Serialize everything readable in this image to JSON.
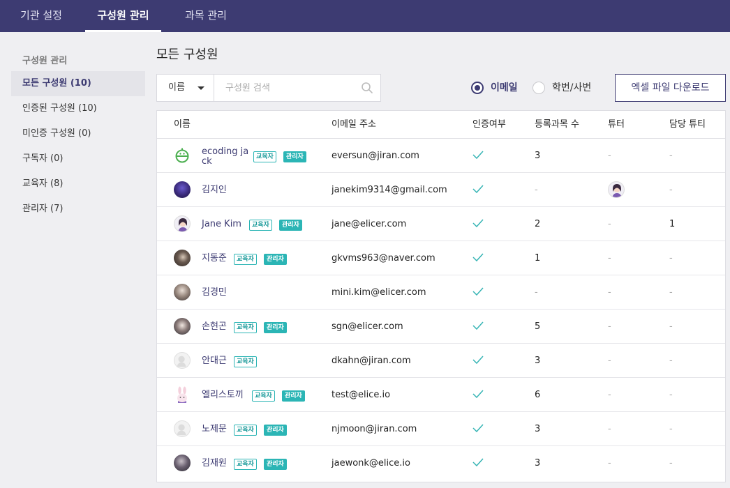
{
  "top_nav": {
    "tabs": [
      {
        "label": "기관 설정",
        "active": false
      },
      {
        "label": "구성원 관리",
        "active": true
      },
      {
        "label": "과목 관리",
        "active": false
      }
    ]
  },
  "sidebar": {
    "title": "구성원 관리",
    "items": [
      {
        "label": "모든 구성원 (10)",
        "active": true
      },
      {
        "label": "인증된 구성원 (10)",
        "active": false
      },
      {
        "label": "미인증 구성원 (0)",
        "active": false
      },
      {
        "label": "구독자 (0)",
        "active": false
      },
      {
        "label": "교육자 (8)",
        "active": false
      },
      {
        "label": "관리자 (7)",
        "active": false
      }
    ]
  },
  "main": {
    "title": "모든 구성원",
    "search": {
      "select_value": "이름",
      "placeholder": "구성원 검색"
    },
    "radio_options": [
      {
        "label": "이메일",
        "checked": true
      },
      {
        "label": "학번/사번",
        "checked": false
      }
    ],
    "download_label": "엑셀 파일 다운로드",
    "table": {
      "headers": [
        "이름",
        "이메일 주소",
        "인증여부",
        "등록과목 수",
        "튜터",
        "담당 튜티"
      ],
      "badge_labels": {
        "edu": "교육자",
        "admin": "관리자"
      },
      "rows": [
        {
          "name": "ecoding jack",
          "email": "eversun@jiran.com",
          "verified": true,
          "courses": "3",
          "tutor": "-",
          "tutee": "-",
          "edu": true,
          "admin": true,
          "avatar": "elice-logo-icon"
        },
        {
          "name": "김지인",
          "email": "janekim9314@gmail.com",
          "verified": true,
          "courses": "-",
          "tutor": "avatar",
          "tutee": "-",
          "edu": false,
          "admin": false,
          "avatar": "purple-avatar-icon"
        },
        {
          "name": "Jane Kim",
          "email": "jane@elicer.com",
          "verified": true,
          "courses": "2",
          "tutor": "-",
          "tutee": "1",
          "edu": true,
          "admin": true,
          "avatar": "girl-avatar-icon"
        },
        {
          "name": "지동준",
          "email": "gkvms963@naver.com",
          "verified": true,
          "courses": "1",
          "tutor": "-",
          "tutee": "-",
          "edu": true,
          "admin": true,
          "avatar": "photo-avatar-icon"
        },
        {
          "name": "김경민",
          "email": "mini.kim@elicer.com",
          "verified": true,
          "courses": "-",
          "tutor": "-",
          "tutee": "-",
          "edu": false,
          "admin": false,
          "avatar": "photo-avatar-icon"
        },
        {
          "name": "손현곤",
          "email": "sgn@elicer.com",
          "verified": true,
          "courses": "5",
          "tutor": "-",
          "tutee": "-",
          "edu": true,
          "admin": true,
          "avatar": "photo-avatar-icon"
        },
        {
          "name": "안대근",
          "email": "dkahn@jiran.com",
          "verified": true,
          "courses": "3",
          "tutor": "-",
          "tutee": "-",
          "edu": true,
          "admin": false,
          "avatar": "default-avatar-icon"
        },
        {
          "name": "엘리스토끼",
          "email": "test@elice.io",
          "verified": true,
          "courses": "6",
          "tutor": "-",
          "tutee": "-",
          "edu": true,
          "admin": true,
          "avatar": "rabbit-avatar-icon"
        },
        {
          "name": "노제문",
          "email": "njmoon@jiran.com",
          "verified": true,
          "courses": "3",
          "tutor": "-",
          "tutee": "-",
          "edu": true,
          "admin": true,
          "avatar": "default-avatar-icon"
        },
        {
          "name": "김재원",
          "email": "jaewonk@elice.io",
          "verified": true,
          "courses": "3",
          "tutor": "-",
          "tutee": "-",
          "edu": true,
          "admin": true,
          "avatar": "photo-avatar-icon"
        }
      ]
    }
  },
  "colors": {
    "nav_bg": "#3d3b72",
    "accent": "#3d3b72",
    "badge_teal": "#2bb5b5",
    "check_teal": "#35b4b4"
  }
}
